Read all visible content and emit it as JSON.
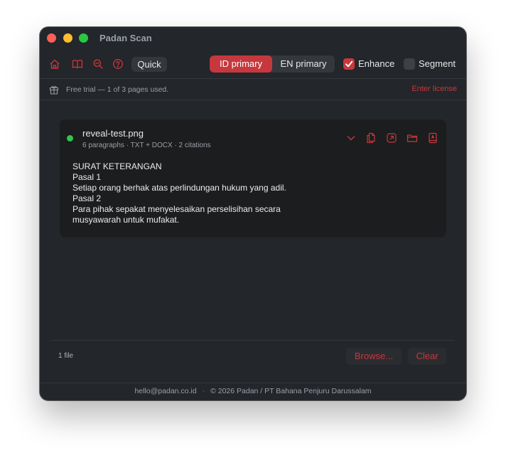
{
  "window": {
    "title": "Padan Scan"
  },
  "toolbar": {
    "icons": [
      "home-icon",
      "book-icon",
      "zoom-out-icon",
      "help-icon"
    ],
    "quick_label": "Quick",
    "primary_options": [
      "ID primary",
      "EN primary"
    ],
    "primary_selected": "ID primary",
    "enhance_label": "Enhance",
    "enhance_checked": true,
    "segment_label": "Segment",
    "segment_checked": false
  },
  "trial": {
    "text": "Free trial — 1 of 3 pages used.",
    "license_link": "Enter license"
  },
  "file_card": {
    "status": "done",
    "filename": "reveal-test.png",
    "meta": "6 paragraphs · TXT + DOCX · 2 citations",
    "actions": [
      "chevron-down-icon",
      "copy-icon",
      "open-external-icon",
      "folder-icon",
      "book-export-icon"
    ],
    "content_lines": [
      "SURAT KETERANGAN",
      "Pasal 1",
      "Setiap orang berhak atas perlindungan hukum yang adil.",
      "Pasal 2",
      "Para pihak sepakat menyelesaikan perselisihan secara",
      "musyawarah untuk mufakat."
    ]
  },
  "bottom": {
    "file_count": "1 file",
    "browse_label": "Browse...",
    "clear_label": "Clear"
  },
  "footer": {
    "email": "hello@padan.co.id",
    "separator": "·",
    "copyright": "© 2026 Padan / PT Bahana Penjuru Darussalam"
  },
  "colors": {
    "accent": "#c6383d",
    "window_bg": "#23262a",
    "card_bg": "#1c1d1f",
    "status_ok": "#2cc84f"
  }
}
